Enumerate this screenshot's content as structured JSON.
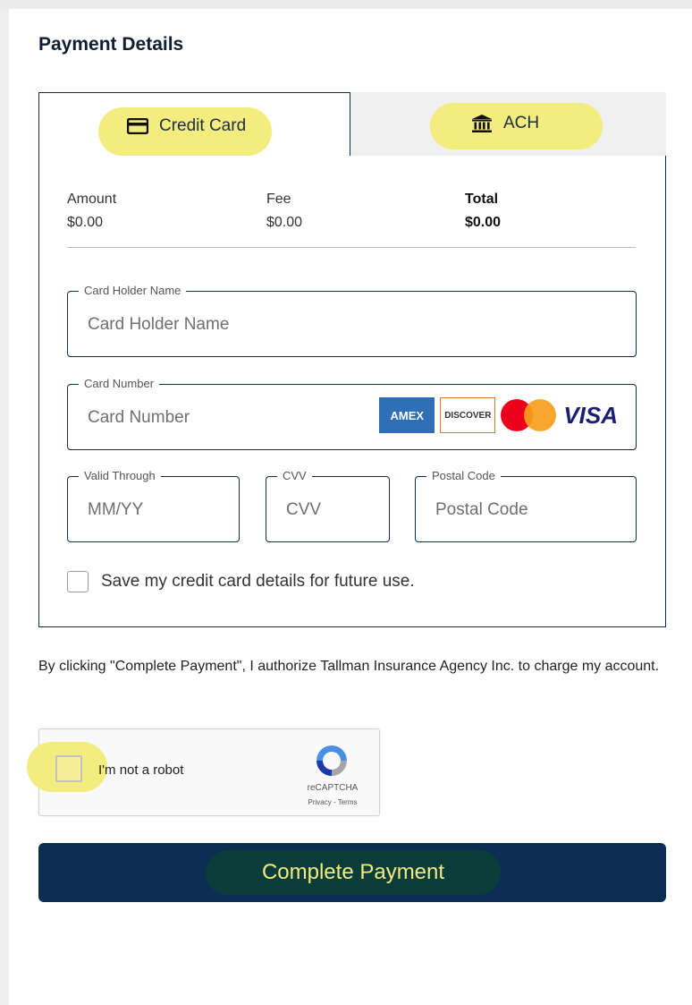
{
  "page": {
    "title": "Payment Details"
  },
  "tabs": [
    {
      "label": "Credit Card",
      "icon": "credit-card-icon",
      "active": true
    },
    {
      "label": "ACH",
      "icon": "bank-icon",
      "active": false
    }
  ],
  "summary": {
    "amount_label": "Amount",
    "amount_value": "$0.00",
    "fee_label": "Fee",
    "fee_value": "$0.00",
    "total_label": "Total",
    "total_value": "$0.00"
  },
  "fields": {
    "card_holder": {
      "legend": "Card Holder Name",
      "placeholder": "Card Holder Name"
    },
    "card_number": {
      "legend": "Card Number",
      "placeholder": "Card Number"
    },
    "valid_through": {
      "legend": "Valid Through",
      "placeholder": "MM/YY"
    },
    "cvv": {
      "legend": "CVV",
      "placeholder": "CVV"
    },
    "postal_code": {
      "legend": "Postal Code",
      "placeholder": "Postal Code"
    }
  },
  "card_brands": {
    "amex": "AMEX",
    "discover": "DISCOVER",
    "visa": "VISA"
  },
  "save_card_label": "Save my credit card details for future use.",
  "authorization_text": "By clicking \"Complete Payment\", I authorize Tallman Insurance Agency Inc. to charge my account.",
  "captcha": {
    "label": "I'm not a robot",
    "brand": "reCAPTCHA",
    "links": "Privacy - Terms"
  },
  "submit_label": "Complete Payment",
  "colors": {
    "navy": "#0b2d52",
    "highlight": "#f3ec7e",
    "button_text": "#f3ec7e"
  }
}
